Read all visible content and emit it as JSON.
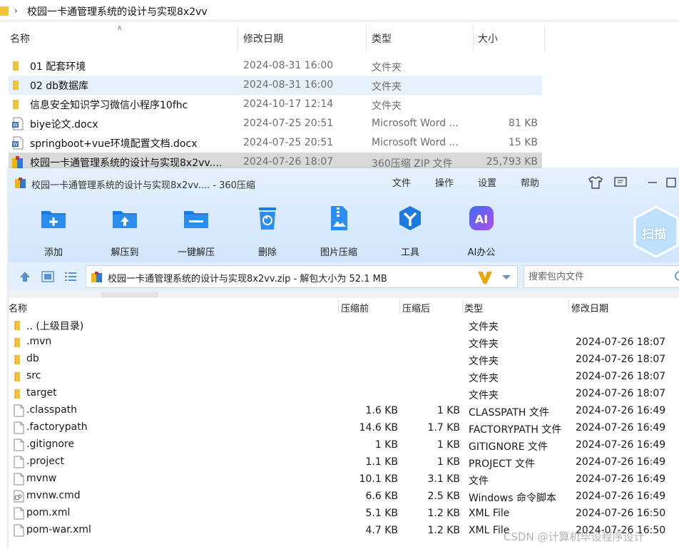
{
  "explorer": {
    "breadcrumb": "校园一卡通管理系统的设计与实现8x2vv",
    "columns": {
      "name": "名称",
      "modified": "修改日期",
      "type": "类型",
      "size": "大小"
    },
    "rows": [
      {
        "name": "01 配套环境",
        "modified": "2024-08-31 16:00",
        "type": "文件夹",
        "size": "",
        "icon": "folder-icon"
      },
      {
        "name": "02 db数据库",
        "modified": "2024-08-31 16:00",
        "type": "文件夹",
        "size": "",
        "icon": "folder-icon"
      },
      {
        "name": "信息安全知识学习微信小程序10fhc",
        "modified": "2024-10-17 12:14",
        "type": "文件夹",
        "size": "",
        "icon": "folder-icon"
      },
      {
        "name": "biye论文.docx",
        "modified": "2024-07-25 20:51",
        "type": "Microsoft Word ...",
        "size": "81 KB",
        "icon": "word-doc-icon"
      },
      {
        "name": "springboot+vue环境配置文档.docx",
        "modified": "2024-07-25 20:51",
        "type": "Microsoft Word ...",
        "size": "15 KB",
        "icon": "word-doc-icon"
      },
      {
        "name": "校园一卡通管理系统的设计与实现8x2vv....",
        "modified": "2024-07-26 18:07",
        "type": "360压缩 ZIP 文件",
        "size": "25,793 KB",
        "icon": "zip-archive-icon"
      }
    ]
  },
  "zip": {
    "title": "校园一卡通管理系统的设计与实现8x2vv.... - 360压缩",
    "menu": [
      "文件",
      "操作",
      "设置",
      "帮助"
    ],
    "toolbar": [
      "添加",
      "解压到",
      "一键解压",
      "删除",
      "图片压缩",
      "工具",
      "AI办公"
    ],
    "scan_label": "扫描",
    "path_text": "校园一卡通管理系统的设计与实现8x2vv.zip - 解包大小为 52.1 MB",
    "search_placeholder": "搜索包内文件",
    "columns": {
      "name": "名称",
      "before": "压缩前",
      "after": "压缩后",
      "type": "类型",
      "modified": "修改日期"
    },
    "rows": [
      {
        "name": ".. (上级目录)",
        "before": "",
        "after": "",
        "type": "文件夹",
        "modified": "",
        "icon": "folder-icon"
      },
      {
        "name": ".mvn",
        "before": "",
        "after": "",
        "type": "文件夹",
        "modified": "2024-07-26 18:07",
        "icon": "folder-icon"
      },
      {
        "name": "db",
        "before": "",
        "after": "",
        "type": "文件夹",
        "modified": "2024-07-26 18:07",
        "icon": "folder-icon"
      },
      {
        "name": "src",
        "before": "",
        "after": "",
        "type": "文件夹",
        "modified": "2024-07-26 18:07",
        "icon": "folder-icon"
      },
      {
        "name": "target",
        "before": "",
        "after": "",
        "type": "文件夹",
        "modified": "2024-07-26 18:07",
        "icon": "folder-icon"
      },
      {
        "name": ".classpath",
        "before": "1.6 KB",
        "after": "1 KB",
        "type": "CLASSPATH 文件",
        "modified": "2024-07-26 16:49",
        "icon": "file-icon"
      },
      {
        "name": ".factorypath",
        "before": "14.6 KB",
        "after": "1.7 KB",
        "type": "FACTORYPATH 文件",
        "modified": "2024-07-26 16:49",
        "icon": "file-icon"
      },
      {
        "name": ".gitignore",
        "before": "1 KB",
        "after": "1 KB",
        "type": "GITIGNORE 文件",
        "modified": "2024-07-26 16:49",
        "icon": "file-icon"
      },
      {
        "name": ".project",
        "before": "1.1 KB",
        "after": "1 KB",
        "type": "PROJECT 文件",
        "modified": "2024-07-26 16:49",
        "icon": "file-icon"
      },
      {
        "name": "mvnw",
        "before": "10.1 KB",
        "after": "3.1 KB",
        "type": "文件",
        "modified": "2024-07-26 16:49",
        "icon": "file-icon"
      },
      {
        "name": "mvnw.cmd",
        "before": "6.6 KB",
        "after": "2.5 KB",
        "type": "Windows 命令脚本",
        "modified": "2024-07-26 16:49",
        "icon": "cmd-script-icon"
      },
      {
        "name": "pom.xml",
        "before": "5.1 KB",
        "after": "1.2 KB",
        "type": "XML File",
        "modified": "2024-07-26 16:50",
        "icon": "file-icon"
      },
      {
        "name": "pom-war.xml",
        "before": "4.7 KB",
        "after": "1.2 KB",
        "type": "XML File",
        "modified": "2024-07-26 16:50",
        "icon": "file-icon"
      }
    ]
  },
  "watermark": "CSDN @计算机毕设程序设计"
}
